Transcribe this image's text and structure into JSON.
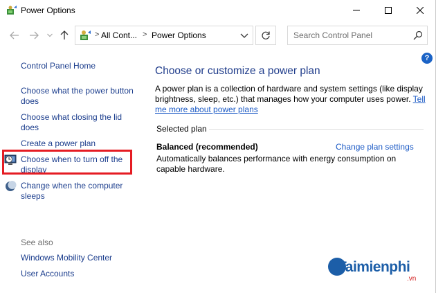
{
  "window": {
    "title": "Power Options"
  },
  "address": {
    "crumb_parent": "All Cont...",
    "crumb_current": "Power Options",
    "chevron": ">"
  },
  "search": {
    "placeholder": "Search Control Panel"
  },
  "help": {
    "label": "?"
  },
  "sidebar": {
    "home": "Control Panel Home",
    "items": [
      {
        "label": "Choose what the power button does"
      },
      {
        "label": "Choose what closing the lid does"
      },
      {
        "label": "Create a power plan"
      },
      {
        "label": "Choose when to turn off the display",
        "icon": "display-clock-icon",
        "highlighted": true
      },
      {
        "label": "Change when the computer sleeps",
        "icon": "moon-icon"
      }
    ],
    "see_also_label": "See also",
    "see_also": [
      {
        "label": "Windows Mobility Center"
      },
      {
        "label": "User Accounts"
      }
    ]
  },
  "main": {
    "heading": "Choose or customize a power plan",
    "description": "A power plan is a collection of hardware and system settings (like display brightness, sleep, etc.) that manages how your computer uses power.",
    "description_link": "Tell me more about power plans",
    "selected_plan_label": "Selected plan",
    "plan": {
      "name": "Balanced (recommended)",
      "change_link": "Change plan settings",
      "description": "Automatically balances performance with energy consumption on capable hardware."
    }
  },
  "watermark": {
    "brand": "Taimienphi",
    "suffix": ".vn"
  },
  "colors": {
    "link": "#1a3c8c",
    "heading": "#1e3b8a",
    "highlight_border": "#e51c23",
    "help": "#1b63c6"
  }
}
